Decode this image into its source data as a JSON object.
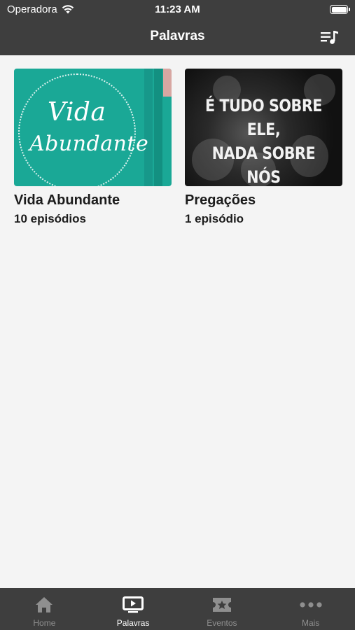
{
  "status_bar": {
    "carrier": "Operadora",
    "time": "11:23 AM"
  },
  "nav": {
    "title": "Palavras"
  },
  "series": [
    {
      "title": "Vida Abundante",
      "subtitle": "10 episódios",
      "thumbnail_text_line1": "Vida",
      "thumbnail_text_line2": "Abundante",
      "thumbnail_color": "#1aa896"
    },
    {
      "title": "Pregações",
      "subtitle": "1 episódio",
      "thumbnail_text_line1": "É TUDO SOBRE ELE,",
      "thumbnail_text_line2": "NADA SOBRE NÓS",
      "thumbnail_color": "#2a2a2a"
    }
  ],
  "tabs": [
    {
      "label": "Home",
      "icon": "home-icon",
      "active": false
    },
    {
      "label": "Palavras",
      "icon": "play-screen-icon",
      "active": true
    },
    {
      "label": "Eventos",
      "icon": "star-ticket-icon",
      "active": false
    },
    {
      "label": "Mais",
      "icon": "more-dots-icon",
      "active": false
    }
  ],
  "colors": {
    "bar_background": "#3e3e3e",
    "page_background": "#f4f4f4",
    "tab_inactive": "#8f8f8f",
    "tab_active": "#ffffff"
  }
}
